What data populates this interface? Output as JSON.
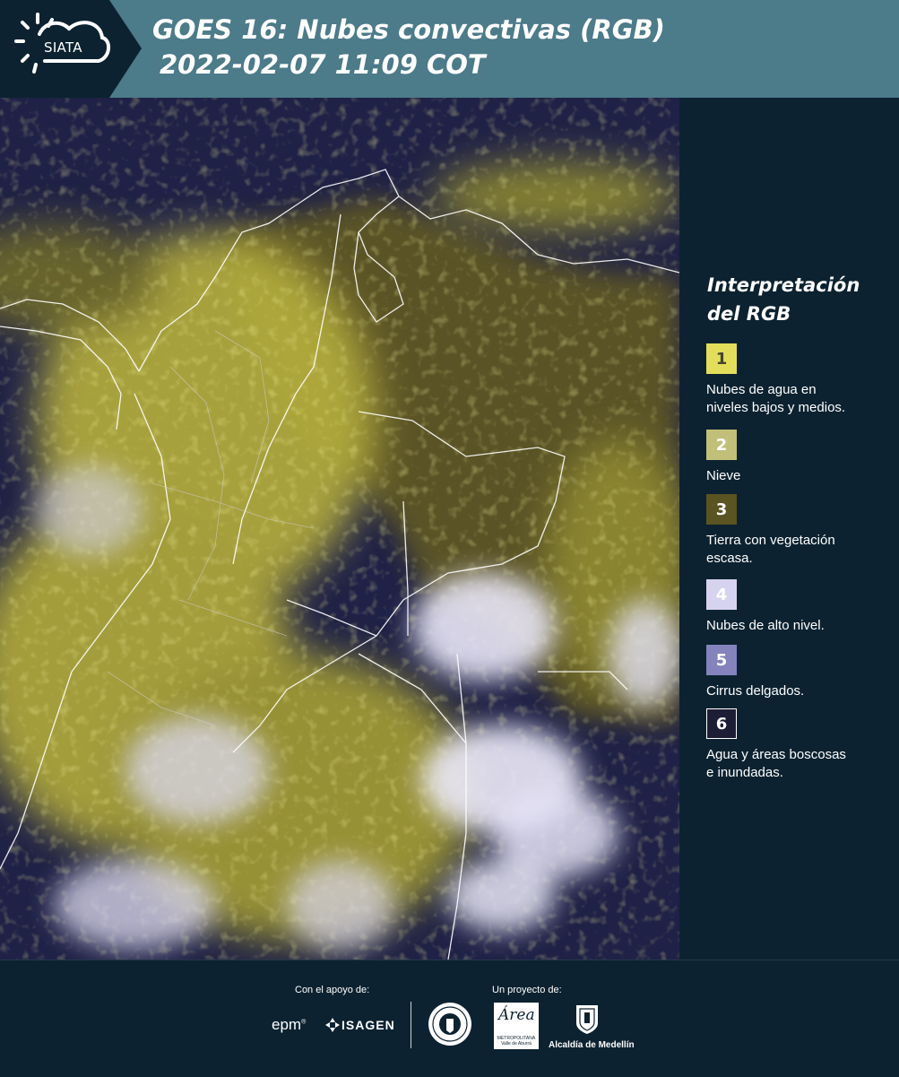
{
  "header": {
    "logo_text": "SIATA",
    "title_line1": "GOES 16: Nubes convectivas (RGB)",
    "title_line2": "2022-02-07 11:09 COT"
  },
  "legend": {
    "title_line1": "Interpretación",
    "title_line2": "del RGB",
    "items": [
      {
        "number": "1",
        "color": "#e3de5a",
        "text_color": "#444433",
        "label_line1": "Nubes de agua en",
        "label_line2": "niveles bajos y medios."
      },
      {
        "number": "2",
        "color": "#c2bf78",
        "text_color": "#ffffff",
        "label_line1": "Nieve",
        "label_line2": ""
      },
      {
        "number": "3",
        "color": "#5a5322",
        "text_color": "#ffffff",
        "label_line1": "Tierra con vegetación",
        "label_line2": "escasa."
      },
      {
        "number": "4",
        "color": "#d6d3f0",
        "text_color": "#ffffff",
        "label_line1": "Nubes de alto nivel.",
        "label_line2": ""
      },
      {
        "number": "5",
        "color": "#8483bd",
        "text_color": "#ffffff",
        "label_line1": "Cirrus delgados.",
        "label_line2": ""
      },
      {
        "number": "6",
        "color": "#1e1d36",
        "text_color": "#ffffff",
        "label_line1": "Agua y áreas boscosas",
        "label_line2": "e inundadas."
      }
    ]
  },
  "footer": {
    "support_label": "Con el apoyo de:",
    "project_label": "Un proyecto de:",
    "sponsor_epm": "epm",
    "sponsor_isagen": "ISAGEN",
    "area_logo_word": "Área",
    "area_logo_sub": "METROPOLITANA Valle de Aburrá",
    "alcaldia": "Alcaldía de Medellín"
  }
}
